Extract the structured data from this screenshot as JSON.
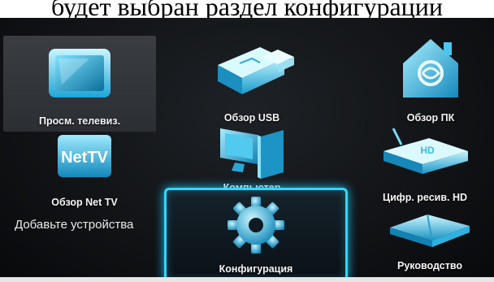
{
  "photo_caption": "будет выбран раздел конфигурации",
  "menu": {
    "tiles": [
      {
        "label": "Просм. телевиз.",
        "icon": "tv-icon"
      },
      {
        "label": "Обзор USB",
        "icon": "usb-icon"
      },
      {
        "label": "Обзор ПК",
        "icon": "home-network-icon"
      },
      {
        "label": "Обзор Net TV",
        "icon": "net-tv-icon"
      },
      {
        "label": "Компьютер",
        "icon": "computer-icon"
      },
      {
        "label": "Цифр. ресив. HD",
        "icon": "hd-receiver-icon"
      },
      {
        "label": "Конфигурация",
        "icon": "gear-icon"
      },
      {
        "label": "Руководство",
        "icon": "book-icon"
      }
    ],
    "add_devices_label": "Добавьте устройства",
    "net_tv_logo_text": "NetTV",
    "hd_badge_text": "HD",
    "selected_tile": "Просм. телевиз.",
    "focused_tile": "Конфигурация"
  },
  "colors": {
    "accent": "#2fd7ff",
    "icon_light": "#b8f2ff",
    "icon_mid": "#39c9ef",
    "icon_dark": "#0f7fae",
    "background": "#121417"
  }
}
